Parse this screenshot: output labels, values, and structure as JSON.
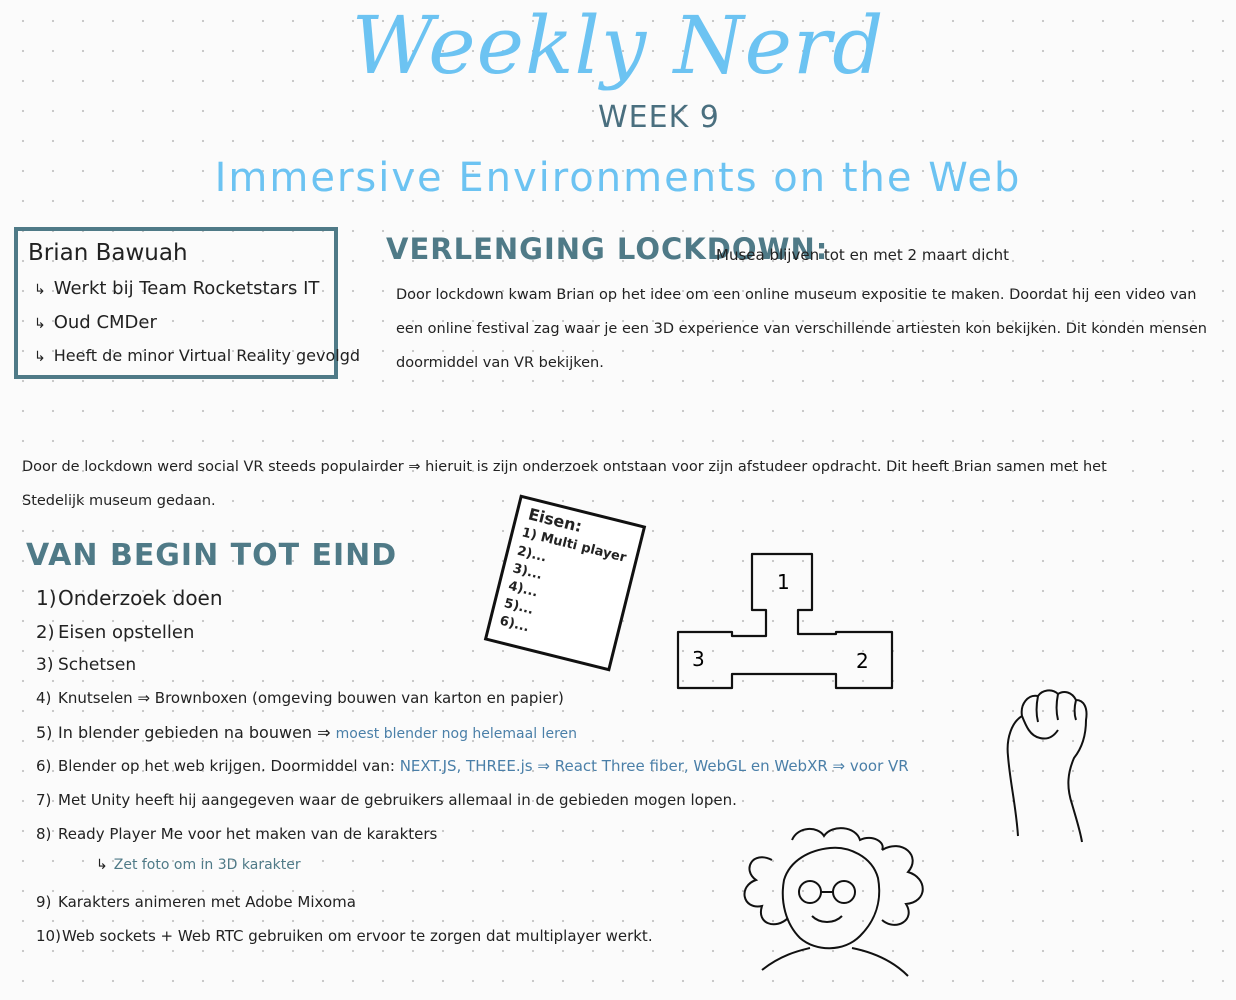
{
  "header": {
    "title": "Weekly Nerd",
    "week": "WEEK 9",
    "subtitle": "Immersive Environments on the Web"
  },
  "speaker": {
    "name": "Brian Bawuah",
    "items": [
      "Werkt bij Team Rocketstars IT",
      "Oud CMDer",
      "Heeft de minor Virtual Reality gevolgd"
    ]
  },
  "lockdown": {
    "heading": "VERLENGING LOCKDOWN:",
    "subheading": "Musea blijven tot en met 2 maart dicht",
    "paragraph": "Door lockdown kwam Brian op het idee om een online museum expositie te maken. Doordat hij een video van een online festival zag waar je een 3D experience van verschillende artiesten kon bekijken. Dit konden mensen doormiddel van VR bekijken."
  },
  "intro": "Door de lockdown werd social VR steeds populairder ⇒ hieruit is zijn onderzoek ontstaan voor zijn afstudeer opdracht. Dit heeft Brian samen met het Stedelijk museum gedaan.",
  "process": {
    "heading": "VAN BEGIN TOT EIND",
    "steps": [
      {
        "num": "1)",
        "text": "Onderzoek doen",
        "extra": ""
      },
      {
        "num": "2)",
        "text": "Eisen opstellen",
        "extra": ""
      },
      {
        "num": "3)",
        "text": "Schetsen",
        "extra": ""
      },
      {
        "num": "4)",
        "text": "Knutselen ⇒ Brownboxen (omgeving bouwen van karton en papier)",
        "extra": ""
      },
      {
        "num": "5)",
        "text": "In blender gebieden na bouwen ⇒",
        "extra": "moest blender nog helemaal leren"
      },
      {
        "num": "6)",
        "text": "Blender op het web krijgen. Doormiddel van:",
        "extra": "NEXT.JS, THREE.js ⇒ React Three fiber, WebGL en WebXR ⇒ voor VR"
      },
      {
        "num": "7)",
        "text": "Met Unity heeft hij aangegeven waar de gebruikers allemaal in de gebieden mogen lopen.",
        "extra": ""
      },
      {
        "num": "8)",
        "text": "Ready Player Me voor het maken van de karakters",
        "extra": ""
      },
      {
        "num": "9)",
        "text": "Karakters animeren met Adobe Mixoma",
        "extra": ""
      },
      {
        "num": "10)",
        "text": "Web sockets + Web RTC gebruiken om ervoor te zorgen dat multiplayer werkt.",
        "extra": ""
      }
    ],
    "step8_sub": "Zet foto om in 3D karakter"
  },
  "requirements_note": {
    "title": "Eisen:",
    "lines": [
      "1) Multi player",
      "2)...",
      "3)...",
      "4)...",
      "5)...",
      "6)..."
    ]
  },
  "map_labels": [
    "1",
    "2",
    "3"
  ]
}
